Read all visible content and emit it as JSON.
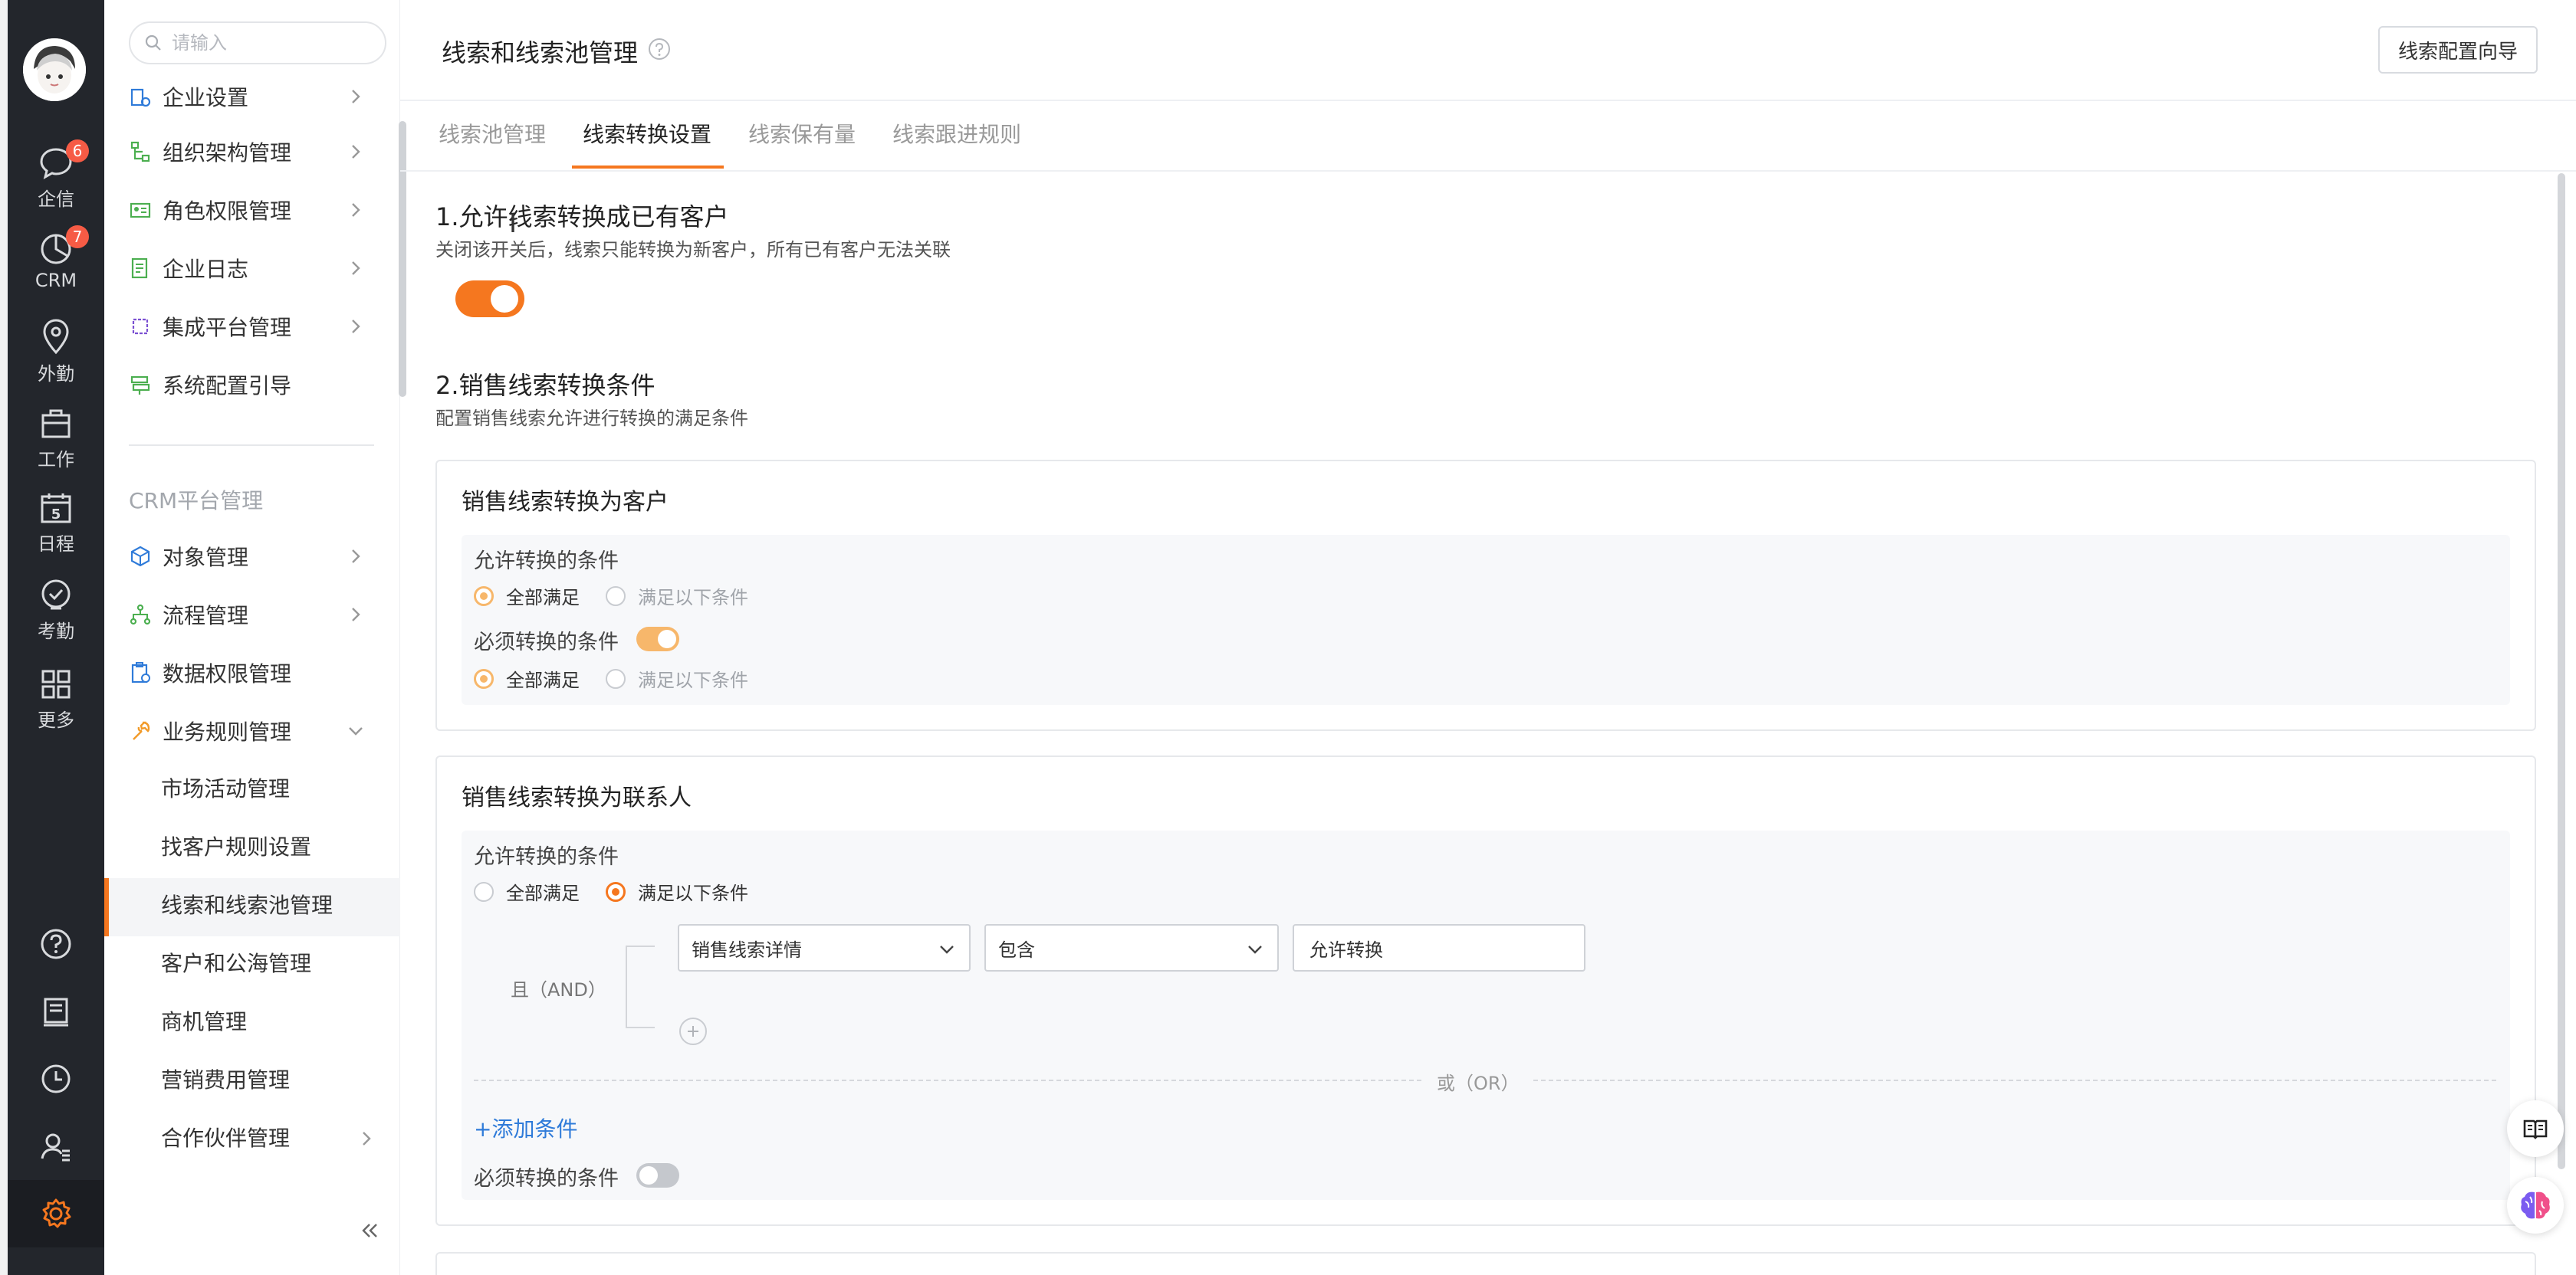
{
  "rail": {
    "items": [
      {
        "label": "企信",
        "badge": "6"
      },
      {
        "label": "CRM",
        "badge": "7"
      },
      {
        "label": "外勤"
      },
      {
        "label": "工作"
      },
      {
        "label": "日程",
        "day": "5"
      },
      {
        "label": "考勤"
      },
      {
        "label": "更多"
      }
    ]
  },
  "menu": {
    "search_placeholder": "请输入",
    "items": [
      {
        "label": "企业设置"
      },
      {
        "label": "组织架构管理"
      },
      {
        "label": "角色权限管理"
      },
      {
        "label": "企业日志"
      },
      {
        "label": "集成平台管理"
      },
      {
        "label": "系统配置引导"
      }
    ],
    "section_label": "CRM平台管理",
    "crm_items": [
      {
        "label": "对象管理"
      },
      {
        "label": "流程管理"
      },
      {
        "label": "数据权限管理"
      },
      {
        "label": "业务规则管理"
      }
    ],
    "sub_items": [
      {
        "label": "市场活动管理"
      },
      {
        "label": "找客户规则设置"
      },
      {
        "label": "线索和线索池管理"
      },
      {
        "label": "客户和公海管理"
      },
      {
        "label": "商机管理"
      },
      {
        "label": "营销费用管理"
      },
      {
        "label": "合作伙伴管理"
      }
    ]
  },
  "header": {
    "title": "线索和线索池管理",
    "wizard_button": "线索配置向导"
  },
  "tabs": [
    {
      "label": "线索池管理"
    },
    {
      "label": "线索转换设置"
    },
    {
      "label": "线索保有量"
    },
    {
      "label": "线索跟进规则"
    }
  ],
  "section1": {
    "title": "1.允许线索转换成已有客户",
    "desc": "关闭该开关后，线索只能转换为新客户，所有已有客户无法关联",
    "toggle_on": true
  },
  "section2": {
    "title": "2.销售线索转换条件",
    "desc": "配置销售线索允许进行转换的满足条件"
  },
  "card_customer": {
    "title": "销售线索转换为客户",
    "allow_label": "允许转换的条件",
    "opt_all": "全部满足",
    "opt_some": "满足以下条件",
    "required_label": "必须转换的条件",
    "required_opt_all": "全部满足",
    "required_opt_some": "满足以下条件"
  },
  "card_contact": {
    "title": "销售线索转换为联系人",
    "allow_label": "允许转换的条件",
    "opt_all": "全部满足",
    "opt_some": "满足以下条件",
    "and_label": "且（AND）",
    "field_select": "销售线索详情",
    "operator_select": "包含",
    "value_input": "允许转换",
    "or_label": "或（OR）",
    "add_condition": "+添加条件",
    "required_label": "必须转换的条件"
  },
  "colors": {
    "accent": "#f5771f",
    "link": "#2f7bd9",
    "rail_bg": "#23262c"
  }
}
